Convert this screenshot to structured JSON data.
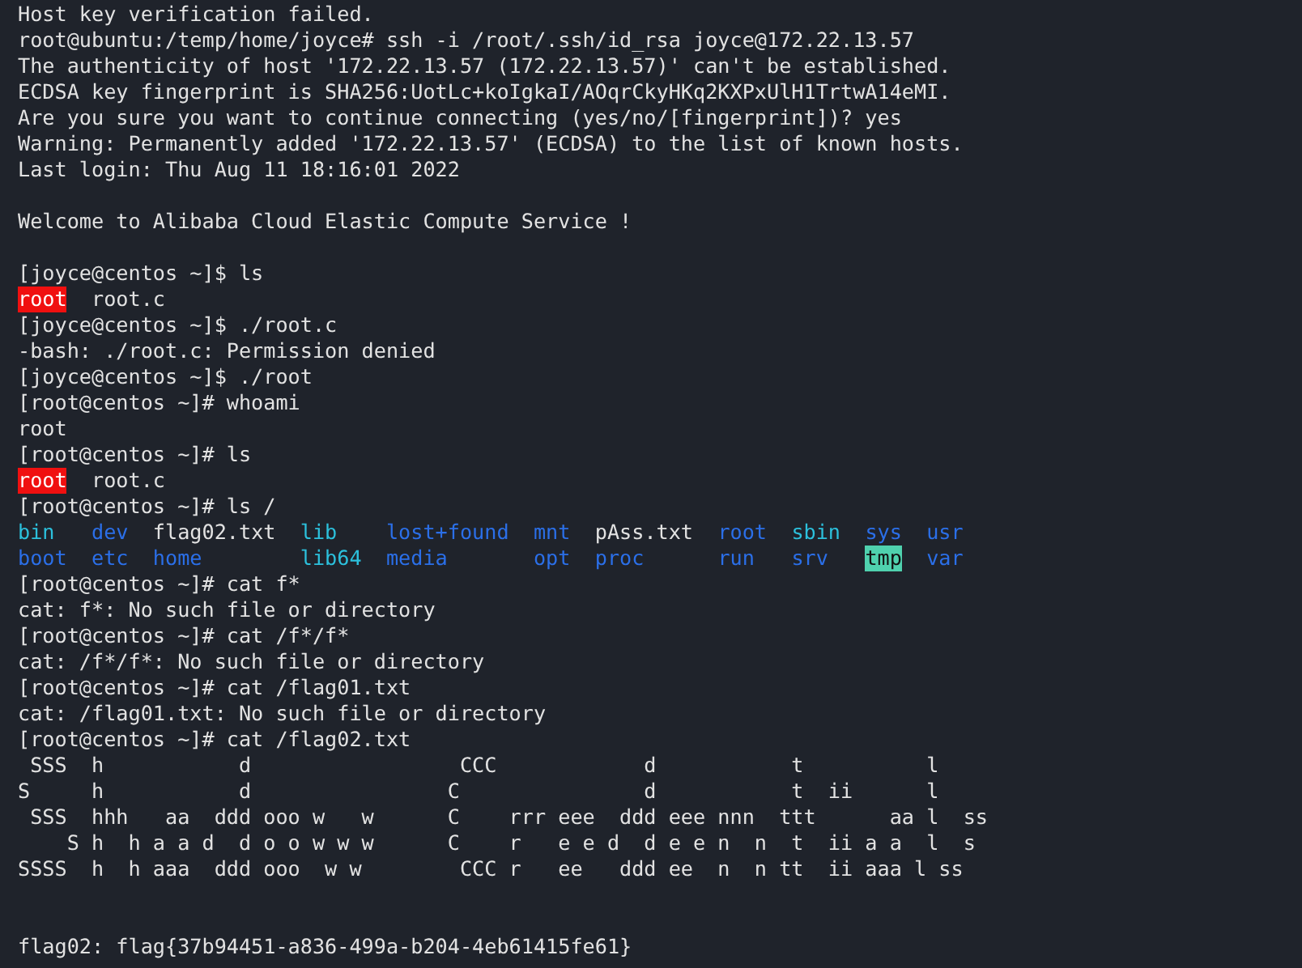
{
  "terminal": {
    "lines": [
      {
        "kind": "text",
        "text": "Host key verification failed."
      },
      {
        "kind": "text",
        "text": "root@ubuntu:/temp/home/joyce# ssh -i /root/.ssh/id_rsa joyce@172.22.13.57"
      },
      {
        "kind": "text",
        "text": "The authenticity of host '172.22.13.57 (172.22.13.57)' can't be established."
      },
      {
        "kind": "text",
        "text": "ECDSA key fingerprint is SHA256:UotLc+koIgkaI/AOqrCkyHKq2KXPxUlH1TrtwA14eMI."
      },
      {
        "kind": "text",
        "text": "Are you sure you want to continue connecting (yes/no/[fingerprint])? yes"
      },
      {
        "kind": "text",
        "text": "Warning: Permanently added '172.22.13.57' (ECDSA) to the list of known hosts."
      },
      {
        "kind": "text",
        "text": "Last login: Thu Aug 11 18:16:01 2022"
      },
      {
        "kind": "blank"
      },
      {
        "kind": "text",
        "text": "Welcome to Alibaba Cloud Elastic Compute Service !"
      },
      {
        "kind": "blank"
      },
      {
        "kind": "text",
        "text": "[joyce@centos ~]$ ls"
      },
      {
        "kind": "files",
        "entries": [
          {
            "name": "root",
            "kind": "setuid"
          },
          {
            "name": "root.c",
            "kind": "file"
          }
        ]
      },
      {
        "kind": "text",
        "text": "[joyce@centos ~]$ ./root.c"
      },
      {
        "kind": "text",
        "text": "-bash: ./root.c: Permission denied"
      },
      {
        "kind": "text",
        "text": "[joyce@centos ~]$ ./root"
      },
      {
        "kind": "text",
        "text": "[root@centos ~]# whoami"
      },
      {
        "kind": "text",
        "text": "root"
      },
      {
        "kind": "text",
        "text": "[root@centos ~]# ls"
      },
      {
        "kind": "files",
        "entries": [
          {
            "name": "root",
            "kind": "setuid"
          },
          {
            "name": "root.c",
            "kind": "file"
          }
        ]
      },
      {
        "kind": "text",
        "text": "[root@centos ~]# ls /"
      },
      {
        "kind": "columns",
        "entries": [
          {
            "name": "bin",
            "kind": "link"
          },
          {
            "name": "boot",
            "kind": "dir"
          },
          {
            "name": "dev",
            "kind": "dir"
          },
          {
            "name": "etc",
            "kind": "dir"
          },
          {
            "name": "flag02.txt",
            "kind": "file"
          },
          {
            "name": "home",
            "kind": "dir"
          },
          {
            "name": "lib",
            "kind": "link"
          },
          {
            "name": "lib64",
            "kind": "link"
          },
          {
            "name": "lost+found",
            "kind": "dir"
          },
          {
            "name": "media",
            "kind": "dir"
          },
          {
            "name": "mnt",
            "kind": "dir"
          },
          {
            "name": "opt",
            "kind": "dir"
          },
          {
            "name": "pAss.txt",
            "kind": "file"
          },
          {
            "name": "proc",
            "kind": "dir"
          },
          {
            "name": "root",
            "kind": "dir"
          },
          {
            "name": "run",
            "kind": "dir"
          },
          {
            "name": "sbin",
            "kind": "link"
          },
          {
            "name": "srv",
            "kind": "dir"
          },
          {
            "name": "sys",
            "kind": "dir"
          },
          {
            "name": "tmp",
            "kind": "sticky"
          },
          {
            "name": "usr",
            "kind": "dir"
          },
          {
            "name": "var",
            "kind": "dir"
          }
        ]
      },
      {
        "kind": "text",
        "text": "[root@centos ~]# cat f*"
      },
      {
        "kind": "text",
        "text": "cat: f*: No such file or directory"
      },
      {
        "kind": "text",
        "text": "[root@centos ~]# cat /f*/f*"
      },
      {
        "kind": "text",
        "text": "cat: /f*/f*: No such file or directory"
      },
      {
        "kind": "text",
        "text": "[root@centos ~]# cat /flag01.txt"
      },
      {
        "kind": "text",
        "text": "cat: /flag01.txt: No such file or directory"
      },
      {
        "kind": "text",
        "text": "[root@centos ~]# cat /flag02.txt"
      },
      {
        "kind": "art",
        "text": " SSS  h           d                 CCC            d           t          l"
      },
      {
        "kind": "art",
        "text": "S     h           d                C               d           t  ii      l"
      },
      {
        "kind": "art",
        "text": " SSS  hhh   aa  ddd ooo w   w      C    rrr eee  ddd eee nnn  ttt      aa l  ss"
      },
      {
        "kind": "art",
        "text": "    S h  h a a d  d o o w w w      C    r   e e d  d e e n  n  t  ii a a  l  s"
      },
      {
        "kind": "art",
        "text": "SSSS  h  h aaa  ddd ooo  w w        CCC r   ee   ddd ee  n  n tt  ii aaa l ss"
      },
      {
        "kind": "blank"
      },
      {
        "kind": "blank"
      },
      {
        "kind": "text",
        "text": "flag02: flag{37b94451-a836-499a-b204-4eb61415fe61}"
      }
    ]
  }
}
